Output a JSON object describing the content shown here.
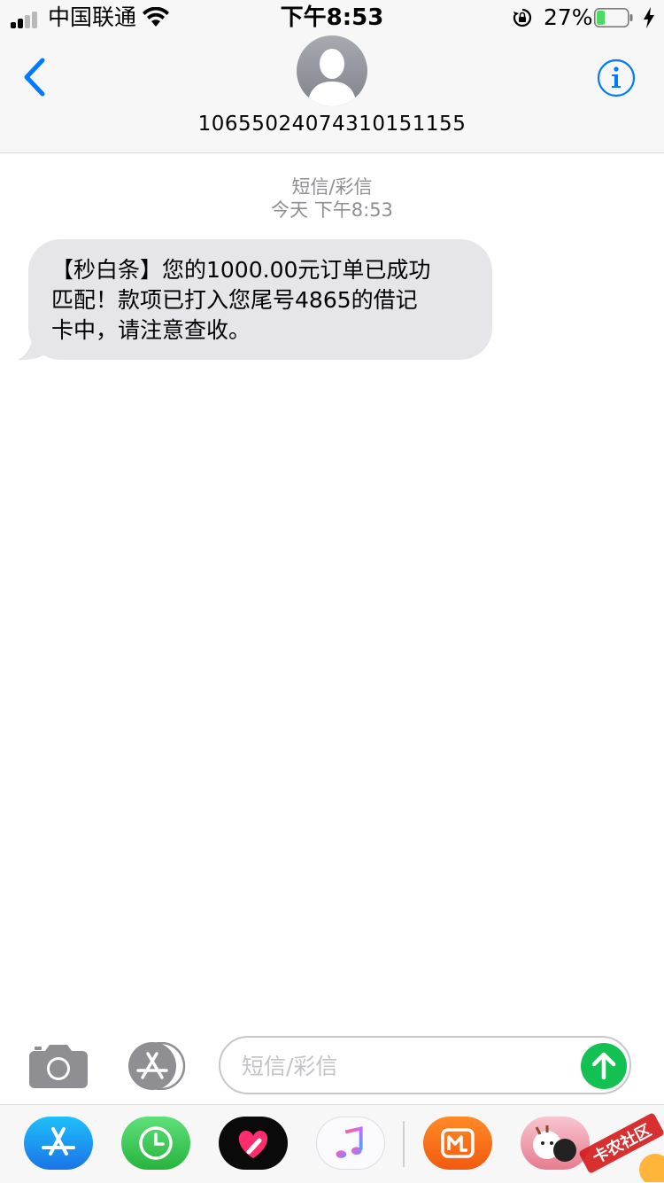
{
  "status_bar": {
    "carrier": "中国联通",
    "time": "下午8:53",
    "battery_percent": "27%",
    "battery_level": 0.27
  },
  "header": {
    "contact_number": "1065502407431015115​5"
  },
  "conversation": {
    "service_label": "短信/彩信",
    "timestamp": "今天 下午8:53",
    "messages": [
      {
        "direction": "incoming",
        "lines": [
          "【秒白条】您的1000.00元订单已成功",
          "匹配！款项已打入您尾号4865的借记",
          "卡中，请注意查收。"
        ]
      }
    ]
  },
  "composer": {
    "placeholder": "短信/彩信"
  },
  "app_drawer": {
    "apps": [
      "app-store",
      "activity",
      "digital-touch",
      "music",
      "mango-tv",
      "stickers"
    ]
  },
  "watermark_text": "卡农社区",
  "colors": {
    "ios_blue": "#007aff",
    "bubble_gray": "#e5e5ea",
    "send_green": "#13c152",
    "battery_green": "#4cd964"
  }
}
